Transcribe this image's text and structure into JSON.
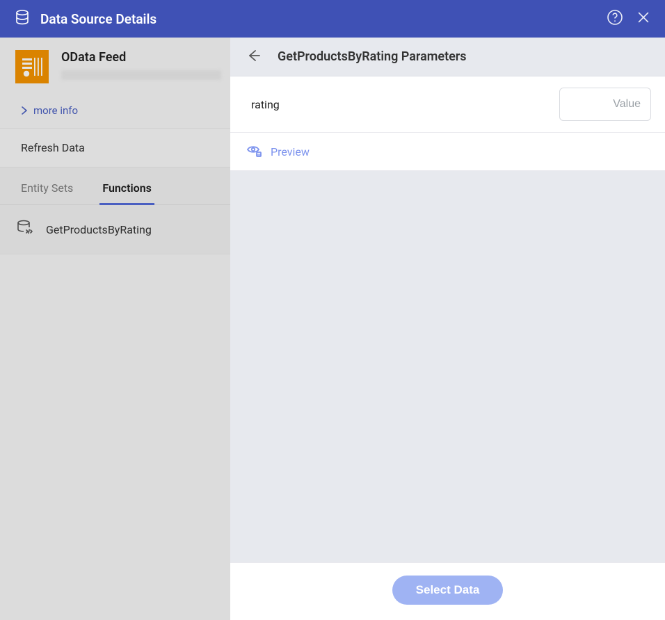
{
  "titlebar": {
    "title": "Data Source Details"
  },
  "left": {
    "source_name": "OData Feed",
    "more_info": "more info",
    "refresh": "Refresh Data",
    "tabs": {
      "entity_sets": "Entity Sets",
      "functions": "Functions"
    },
    "function_item": "GetProductsByRating"
  },
  "right": {
    "header": "GetProductsByRating Parameters",
    "param_label": "rating",
    "value_placeholder": "Value",
    "preview": "Preview",
    "select_button": "Select Data"
  }
}
